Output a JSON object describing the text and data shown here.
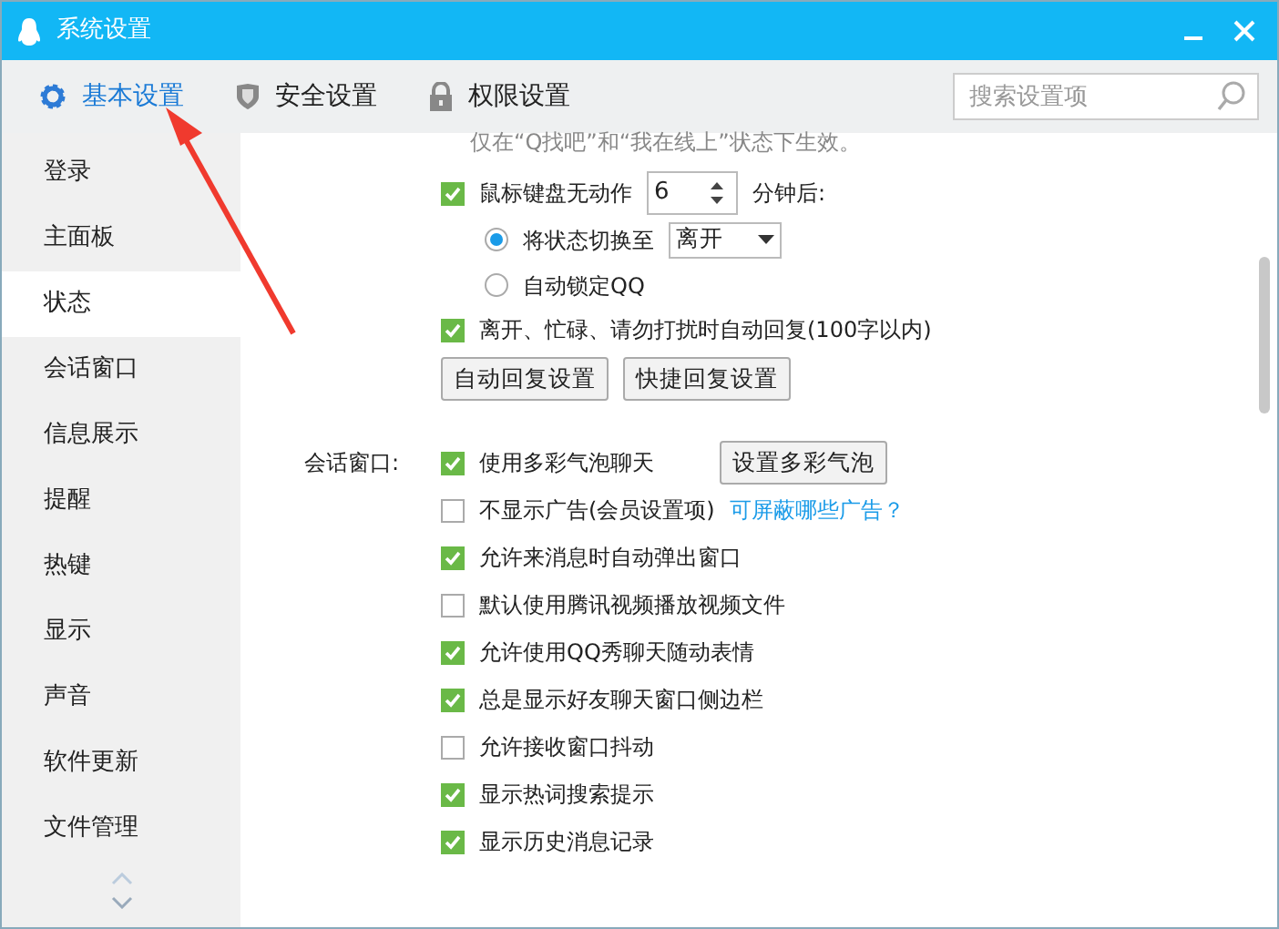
{
  "window": {
    "title": "系统设置"
  },
  "tabs": [
    {
      "label": "基本设置",
      "selected": true,
      "kind": "gear"
    },
    {
      "label": "安全设置",
      "selected": false,
      "kind": "shield"
    },
    {
      "label": "权限设置",
      "selected": false,
      "kind": "lock"
    }
  ],
  "search": {
    "placeholder": "搜索设置项"
  },
  "sidebar": {
    "items": [
      {
        "label": "登录",
        "selected": false
      },
      {
        "label": "主面板",
        "selected": false
      },
      {
        "label": "状态",
        "selected": true
      },
      {
        "label": "会话窗口",
        "selected": false
      },
      {
        "label": "信息展示",
        "selected": false
      },
      {
        "label": "提醒",
        "selected": false
      },
      {
        "label": "热键",
        "selected": false
      },
      {
        "label": "显示",
        "selected": false
      },
      {
        "label": "声音",
        "selected": false
      },
      {
        "label": "软件更新",
        "selected": false
      },
      {
        "label": "文件管理",
        "selected": false
      }
    ]
  },
  "status": {
    "note": "仅在“Q找吧”和“我在线上”状态下生效。",
    "idle": {
      "checked": true,
      "label": "鼠标键盘无动作",
      "value": "6",
      "suffix": "分钟后:"
    },
    "radios": [
      {
        "label": "将状态切换至",
        "selected": true,
        "dropdown": "离开"
      },
      {
        "label": "自动锁定QQ",
        "selected": false
      }
    ],
    "auto_reply": {
      "checked": true,
      "label": "离开、忙碌、请勿打扰时自动回复(100字以内)"
    },
    "buttons": [
      "自动回复设置",
      "快捷回复设置"
    ]
  },
  "session": {
    "label": "会话窗口:",
    "options": [
      {
        "label": "使用多彩气泡聊天",
        "checked": true,
        "button": "设置多彩气泡"
      },
      {
        "label": "不显示广告(会员设置项)",
        "checked": false,
        "link": "可屏蔽哪些广告？"
      },
      {
        "label": "允许来消息时自动弹出窗口",
        "checked": true
      },
      {
        "label": "默认使用腾讯视频播放视频文件",
        "checked": false
      },
      {
        "label": "允许使用QQ秀聊天随动表情",
        "checked": true
      },
      {
        "label": "总是显示好友聊天窗口侧边栏",
        "checked": true
      },
      {
        "label": "允许接收窗口抖动",
        "checked": false
      },
      {
        "label": "显示热词搜索提示",
        "checked": true
      },
      {
        "label": "显示历史消息记录",
        "checked": true
      }
    ]
  }
}
